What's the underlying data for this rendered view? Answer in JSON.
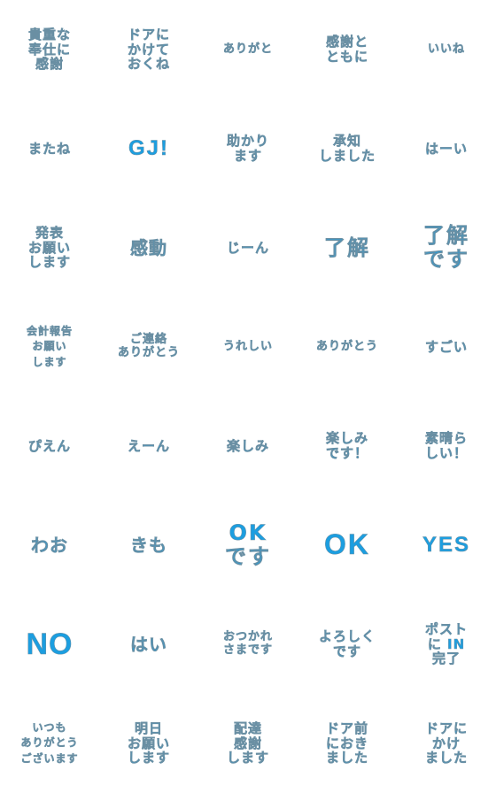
{
  "sticker_sheet": {
    "text_color": "#1c9ee0",
    "stickers": [
      {
        "text": "貴重な\n奉仕に\n感謝"
      },
      {
        "text": "ドアに\nかけて\nおくね"
      },
      {
        "text": "ありがと"
      },
      {
        "text": "感謝と\nともに"
      },
      {
        "text": "いいね"
      },
      {
        "text": "またね"
      },
      {
        "text": "GJ!"
      },
      {
        "text": "助かり\nます"
      },
      {
        "text": "承知\nしました"
      },
      {
        "text": "はーい"
      },
      {
        "text": "発表\nお願い\nします"
      },
      {
        "text": "感動"
      },
      {
        "text": "じーん"
      },
      {
        "text": "了解"
      },
      {
        "text": "了解\nです"
      },
      {
        "text": "会計報告\nお願い\nします"
      },
      {
        "text": "ご連絡\nありがとう"
      },
      {
        "text": "うれしい"
      },
      {
        "text": "ありがとう"
      },
      {
        "text": "すごい"
      },
      {
        "text": "ぴえん"
      },
      {
        "text": "えーん"
      },
      {
        "text": "楽しみ"
      },
      {
        "text": "楽しみ\nです！"
      },
      {
        "text": "素晴ら\nしい！"
      },
      {
        "text": "わお"
      },
      {
        "text": "きも"
      },
      {
        "text": "OK\nです"
      },
      {
        "text": "OK"
      },
      {
        "text": "YES"
      },
      {
        "text": "NO"
      },
      {
        "text": "はい"
      },
      {
        "text": "おつかれ\nさまです"
      },
      {
        "text": "よろしく\nです"
      },
      {
        "text": "ポスト\nに IN\n完了"
      },
      {
        "text": "いつも\nありがとう\nございます"
      },
      {
        "text": "明日\nお願い\nします"
      },
      {
        "text": "配達\n感謝\nします"
      },
      {
        "text": "ドア前\nにおき\nました"
      },
      {
        "text": "ドアに\nかけ\nました"
      }
    ]
  }
}
